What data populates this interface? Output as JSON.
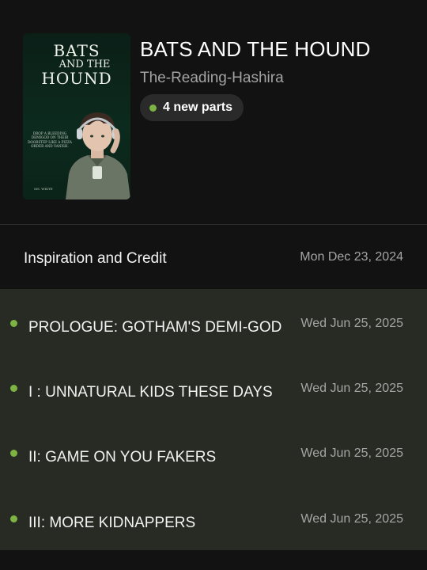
{
  "story": {
    "title": "BATS AND THE HOUND",
    "author": "The-Reading-Hashira",
    "new_parts_label": "4 new parts",
    "cover": {
      "title_line1": "BATS",
      "title_line2": "AND THE",
      "title_line3": "HOUND",
      "blurb": "Drop a bleeding demigod on their doorstep like a pizza order and vanish.",
      "author": "MS. WRITE"
    }
  },
  "colors": {
    "new_dot": "#7cb342",
    "new_area": "#282b23",
    "background": "#121212"
  },
  "parts": [
    {
      "title": "Inspiration and Credit",
      "date": "Mon Dec 23, 2024",
      "is_new": false
    },
    {
      "title": "PROLOGUE: GOTHAM'S DEMI-GOD",
      "date": "Wed Jun 25, 2025",
      "is_new": true
    },
    {
      "title": "I : UNNATURAL KIDS THESE DAYS",
      "date": "Wed Jun 25, 2025",
      "is_new": true
    },
    {
      "title": "II: GAME ON YOU FAKERS",
      "date": "Wed Jun 25, 2025",
      "is_new": true
    },
    {
      "title": "III: MORE KIDNAPPERS",
      "date": "Wed Jun 25, 2025",
      "is_new": true
    }
  ]
}
